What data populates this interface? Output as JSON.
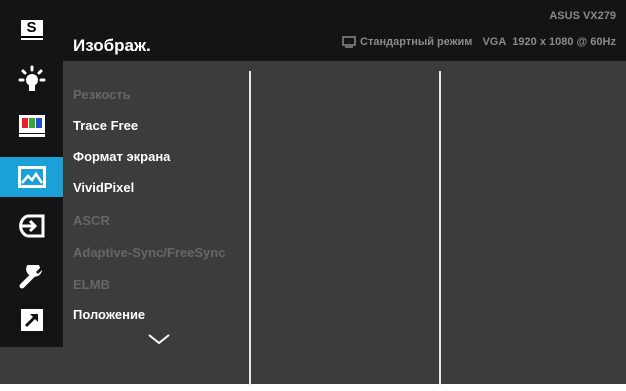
{
  "sidebar": {
    "splendid_label": "S",
    "items": [
      {
        "icon": "splendid-icon"
      },
      {
        "icon": "brightness-icon"
      },
      {
        "icon": "color-icon"
      },
      {
        "icon": "image-icon",
        "active": true
      },
      {
        "icon": "input-select-icon"
      },
      {
        "icon": "system-setup-icon"
      },
      {
        "icon": "shortcut-icon"
      }
    ]
  },
  "header": {
    "title": "Изображ.",
    "model": "ASUS VX279",
    "mode": "Стандартный режим",
    "input": "VGA",
    "resolution": "1920 x 1080 @ 60Hz"
  },
  "menu": {
    "items": [
      {
        "label": "Резкость",
        "enabled": false
      },
      {
        "label": "Trace Free",
        "enabled": true
      },
      {
        "label": "Формат экрана",
        "enabled": true
      },
      {
        "label": "VividPixel",
        "enabled": true
      },
      {
        "label": "ASCR",
        "enabled": false
      },
      {
        "label": "Adaptive-Sync/FreeSync",
        "enabled": false
      },
      {
        "label": "ELMB",
        "enabled": false
      },
      {
        "label": "Положение",
        "enabled": true
      }
    ]
  },
  "colors": {
    "accent": "#1aa2d8",
    "background": "#3c3c3c",
    "header": "#141414",
    "text_enabled": "#ffffff",
    "text_disabled": "#666666",
    "status_text": "#8a8a8a"
  }
}
